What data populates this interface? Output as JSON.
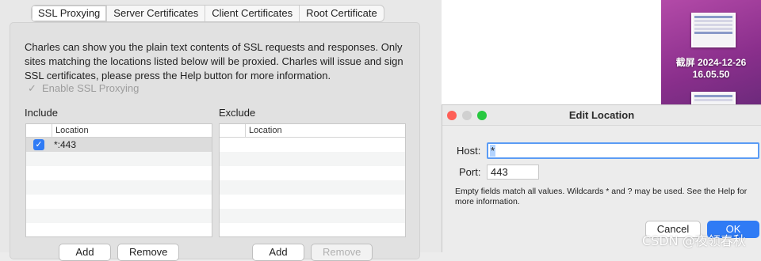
{
  "tabs": [
    {
      "label": "SSL Proxying",
      "active": true
    },
    {
      "label": "Server Certificates",
      "active": false
    },
    {
      "label": "Client Certificates",
      "active": false
    },
    {
      "label": "Root Certificate",
      "active": false
    }
  ],
  "description": "Charles can show you the plain text contents of SSL requests and responses. Only sites matching the locations listed below will be proxied. Charles will issue and sign SSL certificates, please press the Help button for more information.",
  "enable_ssl": {
    "label": "Enable SSL Proxying",
    "checked": true,
    "disabled": true
  },
  "include": {
    "title": "Include",
    "column_header": "Location",
    "rows": [
      {
        "location": "*:443",
        "checked": true
      }
    ],
    "add_label": "Add",
    "remove_label": "Remove"
  },
  "exclude": {
    "title": "Exclude",
    "column_header": "Location",
    "rows": [],
    "add_label": "Add",
    "remove_label": "Remove"
  },
  "desktop": {
    "screenshot_label_line1": "截屏 2024-12-26",
    "screenshot_label_line2": "16.05.50"
  },
  "dialog": {
    "title": "Edit Location",
    "host_label": "Host:",
    "host_value": "*",
    "port_label": "Port:",
    "port_value": "443",
    "hint": "Empty fields match all values. Wildcards * and ? may be used. See the Help for more information.",
    "cancel_label": "Cancel",
    "ok_label": "OK"
  },
  "watermark": "CSDN @夜领春秋",
  "colors": {
    "accent": "#2f7bf5",
    "traffic_red": "#fe5f57",
    "traffic_green": "#28c840",
    "desktop_bg": "#8a2f8c"
  }
}
